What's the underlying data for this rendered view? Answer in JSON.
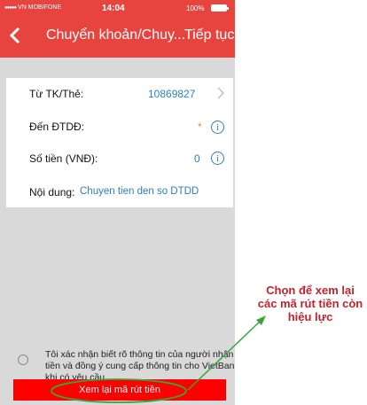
{
  "status_bar": {
    "carrier": "VN MOBIFONE",
    "time": "14:04",
    "battery": "100%"
  },
  "header": {
    "title": "Chuyển khoản/Chuy...",
    "next_label": "Tiếp tục"
  },
  "form": {
    "from_label": "Từ TK/Thẻ:",
    "from_value": "10869827",
    "to_label": "Đến ĐTDĐ:",
    "to_value": "*",
    "amount_label": "Số tiền (VNĐ):",
    "amount_value": "0",
    "content_label": "Nội dung:",
    "content_value": "Chuyen tien den so DTDD"
  },
  "agreement": {
    "text": "Tôi xác nhận biết rõ thông tin của người nhận tiền và đồng ý cung cấp thông tin cho VietBank khi có yêu cầu"
  },
  "button": {
    "label": "Xem lại mã rút tiền"
  },
  "annotation": {
    "text": "Chọn để xem lại các mã rút tiền còn hiệu lực",
    "color": "#c0232b"
  },
  "icons": {
    "back": "chevron-left-icon",
    "chevron": "chevron-right-icon",
    "info": "info-icon"
  },
  "colors": {
    "header": "#e8443f",
    "accent": "#2b7fc0",
    "button": "#ff0000",
    "star": "#f08c2b"
  }
}
